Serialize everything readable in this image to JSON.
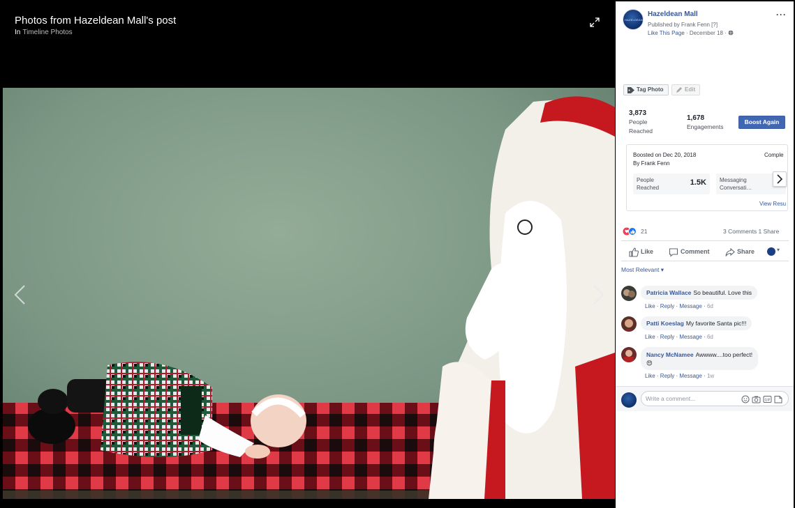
{
  "viewer": {
    "title": "Photos from Hazeldean Mall's post",
    "sub_prefix": "In",
    "sub_album": "Timeline Photos"
  },
  "page": {
    "avatar_text": "HAZELDEAN",
    "name": "Hazeldean Mall",
    "published": "Published by Frank Fenn [?]",
    "like_link": "Like This Page",
    "date": "· December 18 ·",
    "more": "···"
  },
  "toolbar": {
    "tag_label": "Tag Photo",
    "edit_label": "Edit"
  },
  "stats": {
    "reached_value": "3,873",
    "reached_label_1": "People",
    "reached_label_2": "Reached",
    "engagement_value": "1,678",
    "engagement_label": "Engagements",
    "boost_label": "Boost Again"
  },
  "boost_card": {
    "line1": "Boosted on Dec 20, 2018",
    "line2": "By Frank Fenn",
    "status": "Comple",
    "metric1_label_1": "People",
    "metric1_label_2": "Reached",
    "metric1_value": "1.5K",
    "metric2_label_1": "Messaging",
    "metric2_label_2": "Conversati…",
    "view_results": "View Resu"
  },
  "reactions": {
    "count": "21",
    "comments_shares": "3 Comments  1 Share"
  },
  "actions": {
    "like": "Like",
    "comment": "Comment",
    "share": "Share",
    "caret": "▾"
  },
  "sort_label": "Most Relevant ▾",
  "comments": [
    {
      "author": "Patricia Wallace",
      "text": "So beautiful. Love this",
      "like": "Like",
      "reply": "Reply",
      "message": "Message",
      "time": "6d"
    },
    {
      "author": "Patti Koeslag",
      "text": "My favorite Santa pic!!!",
      "like": "Like",
      "reply": "Reply",
      "message": "Message",
      "time": "6d"
    },
    {
      "author": "Nancy McNamee",
      "text": "Awwww....too perfect!",
      "emoji": "😍",
      "like": "Like",
      "reply": "Reply",
      "message": "Message",
      "time": "1w"
    }
  ],
  "write": {
    "placeholder": "Write a comment..."
  },
  "colors": {
    "fb_blue": "#4267b2",
    "link": "#385898",
    "backdrop": "#7e9a86",
    "blanket_red": "#c8202e",
    "santa_red": "#c6181f"
  }
}
